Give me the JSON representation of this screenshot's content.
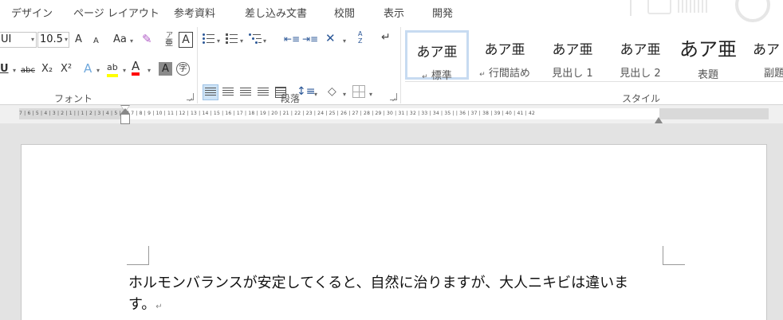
{
  "tabs": [
    "デザイン",
    "ページ レイアウト",
    "参考資料",
    "差し込み文書",
    "校閲",
    "表示",
    "開発"
  ],
  "font_group": {
    "font_name": "UI",
    "font_size": "10.5",
    "grow_label": "A",
    "shrink_label": "A",
    "case_label": "Aa",
    "phonetic_top": "ア",
    "phonetic_bottom": "亜",
    "char_border_label": "A",
    "underline_label": "U",
    "strike_label": "abc",
    "subscript_label": "X₂",
    "superscript_label": "X²",
    "effects_label": "A",
    "highlight_label": "ab",
    "font_color_label": "A",
    "shading_label": "A",
    "enclose_label": "字",
    "label": "フォント",
    "highlight_color": "#ffff00",
    "font_color": "#ff0000"
  },
  "paragraph_group": {
    "label": "段落",
    "sort_label": "A Z"
  },
  "styles_group": {
    "label": "スタイル",
    "items": [
      {
        "sample": "あア亜",
        "name": "標準",
        "mark": "↵"
      },
      {
        "sample": "あア亜",
        "name": "行間詰め",
        "mark": "↵"
      },
      {
        "sample": "あア亜",
        "name": "見出し 1"
      },
      {
        "sample": "あア亜",
        "name": "見出し 2"
      },
      {
        "sample": "あア亜",
        "name": "表題"
      },
      {
        "sample": "あア",
        "name": "副題"
      }
    ]
  },
  "ruler": {
    "ticks": "7 | 6 | 5 | 4 | 3 | 2 | 1 |   | 1 | 2 | 3 | 4 | 5 | 6 | 7 | 8 | 9 | 10 | 11 | 12 | 13 | 14 | 15 | 16 | 17 | 18 | 19 | 20 | 21 | 22 | 23 | 24 | 25 | 26 | 27 | 28 | 29 | 30 | 31 | 32 | 33 | 34 | 35 |   | 36 | 37 | 38 | 39 | 40 | 41 | 42"
  },
  "document": {
    "text": "ホルモンバランスが安定してくると、自然に治りますが、大人ニキビは違います。",
    "paragraph_mark": "↵"
  }
}
